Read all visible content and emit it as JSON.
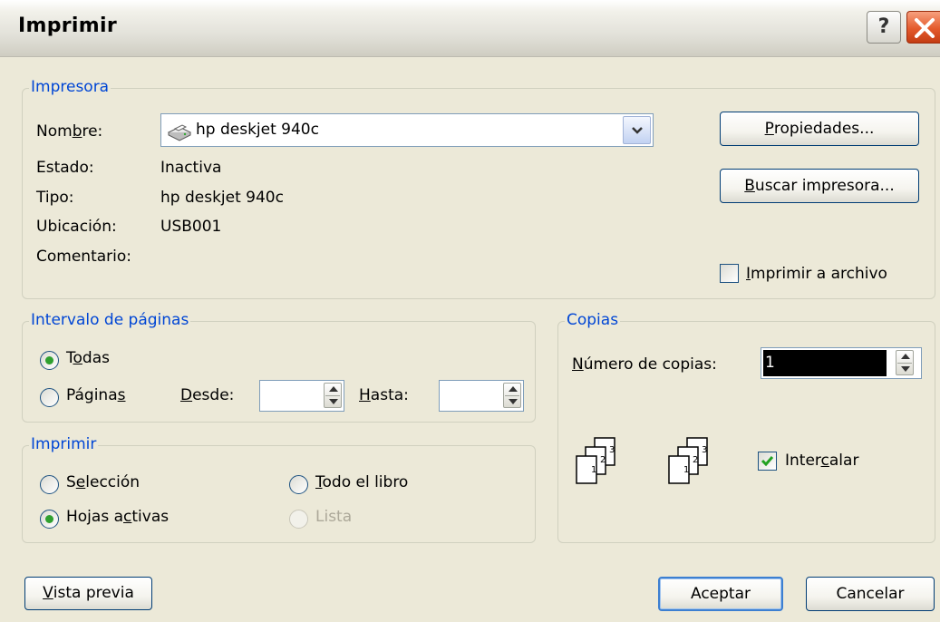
{
  "window": {
    "title": "Imprimir",
    "help_glyph": "?",
    "close_icon": "close-icon"
  },
  "printer": {
    "group_title": "Impresora",
    "name_label_prefix": "Nom",
    "name_label_mnemonic": "b",
    "name_label_suffix": "re:",
    "selected_printer": "hp deskjet 940c",
    "printer_icon": "printer-icon",
    "status_label": "Estado:",
    "status_value": "Inactiva",
    "type_label": "Tipo:",
    "type_value": "hp deskjet 940c",
    "location_label": "Ubicación:",
    "location_value": "USB001",
    "comment_label": "Comentario:",
    "comment_value": "",
    "properties_button": {
      "mnemonic": "P",
      "rest": "ropiedades..."
    },
    "find_button": {
      "mnemonic": "B",
      "rest": "uscar impresora..."
    },
    "print_to_file": {
      "mnemonic": "I",
      "rest": "mprimir a archivo",
      "checked": false
    }
  },
  "page_range": {
    "group_title": "Intervalo de páginas",
    "all": {
      "prefix": "T",
      "mnemonic": "o",
      "suffix": "das",
      "selected": true
    },
    "pages": {
      "prefix": "Página",
      "mnemonic": "s",
      "suffix": "",
      "selected": false
    },
    "from_label": {
      "mnemonic": "D",
      "rest": "esde:"
    },
    "from_value": "",
    "to_label": {
      "mnemonic": "H",
      "rest": "asta:"
    },
    "to_value": ""
  },
  "print_what": {
    "group_title": "Imprimir",
    "selection": {
      "prefix": "S",
      "mnemonic": "e",
      "suffix": "lección",
      "selected": false
    },
    "whole_book": {
      "prefix": "",
      "mnemonic": "T",
      "suffix": "odo el libro",
      "selected": false
    },
    "active_sheets": {
      "prefix": "Hojas a",
      "mnemonic": "c",
      "suffix": "tivas",
      "selected": true
    },
    "list": {
      "label": "Lista",
      "selected": false,
      "disabled": true
    }
  },
  "copies": {
    "group_title": "Copias",
    "count_label": {
      "mnemonic": "N",
      "rest": "úmero de copias:"
    },
    "count_value": "1",
    "collate": {
      "prefix": "Inter",
      "mnemonic": "c",
      "suffix": "alar",
      "checked": true
    },
    "collate_icon": "collate-pages-icon",
    "page_numbers": [
      "1",
      "2",
      "3"
    ]
  },
  "footer": {
    "preview_button": {
      "mnemonic": "V",
      "rest": "ista previa"
    },
    "ok_button": "Aceptar",
    "cancel_button": "Cancelar"
  },
  "colors": {
    "dialog_bg": "#ece9d8",
    "group_title": "#0046d5",
    "button_border": "#003c74",
    "radio_dot": "#2fa02f",
    "check_mark": "#21a121",
    "selection_bg": "#000000"
  }
}
